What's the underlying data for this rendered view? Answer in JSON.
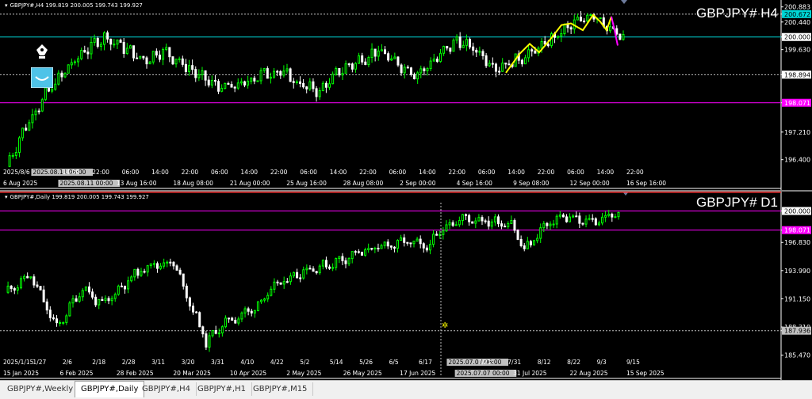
{
  "charts": {
    "h4": {
      "header": "GBPJPY#,H4  199.819 200.005 199.743 199.927",
      "title": "GBPJPY# H4",
      "price_labels": [
        {
          "text": "200.883",
          "price": 200.883,
          "bg": "#000000",
          "fg": "#ffffff"
        },
        {
          "text": "200.672",
          "price": 200.672,
          "bg": "#00d5d5",
          "fg": "#000000"
        },
        {
          "text": "200.440",
          "price": 200.44,
          "bg": "#000000",
          "fg": "#ffffff"
        },
        {
          "text": "200.000",
          "price": 200.0,
          "bg": "#ffffff",
          "fg": "#000000"
        },
        {
          "text": "199.630",
          "price": 199.63,
          "bg": "#000000",
          "fg": "#ffffff"
        },
        {
          "text": "198.894",
          "price": 198.894,
          "bg": "#ffffff",
          "fg": "#000000"
        },
        {
          "text": "198.071",
          "price": 198.071,
          "bg": "#ff00ff",
          "fg": "#ffffff"
        },
        {
          "text": "197.210",
          "price": 197.21,
          "bg": "#000000",
          "fg": "#ffffff"
        },
        {
          "text": "196.400",
          "price": 196.4,
          "bg": "#000000",
          "fg": "#ffffff"
        }
      ],
      "time_labels_top": [
        "2025/8/6",
        "2025.08.11 06:00",
        "14:00",
        "22:00",
        "06:00",
        "14:00",
        "22:00",
        "06:00",
        "14:00",
        "22:00",
        "06:00",
        "14:00",
        "22:00",
        "06:00",
        "14:00",
        "22:00",
        "06:00",
        "14:00",
        "22:00",
        "06:00",
        "14:00",
        "22:00"
      ],
      "time_labels_bottom": [
        "6 Aug 2025",
        "2025.08.11 00:00",
        "13 Aug 16:00",
        "18 Aug 08:00",
        "21 Aug 00:00",
        "25 Aug 16:00",
        "28 Aug 08:00",
        "2 Sep 00:00",
        "4 Sep 16:00",
        "9 Sep 08:00",
        "12 Sep 00:00",
        "16 Sep 16:00"
      ],
      "lines": {
        "cyan": "#00d5d5",
        "magenta": "#ff00ff",
        "dotted": "#c0c0c0"
      }
    },
    "d1": {
      "header": "GBPJPY#,Daily  199.819 200.005 199.743 199.927",
      "title": "GBPJPY# D1",
      "price_labels": [
        {
          "text": "200.000",
          "price": 200.0,
          "bg": "#ffffff",
          "fg": "#000000"
        },
        {
          "text": "198.071",
          "price": 198.071,
          "bg": "#ff00ff",
          "fg": "#ffffff"
        },
        {
          "text": "196.830",
          "price": 196.83,
          "bg": "#000000",
          "fg": "#ffffff"
        },
        {
          "text": "193.990",
          "price": 193.99,
          "bg": "#000000",
          "fg": "#ffffff"
        },
        {
          "text": "191.150",
          "price": 191.15,
          "bg": "#000000",
          "fg": "#ffffff"
        },
        {
          "text": "188.310",
          "price": 188.31,
          "bg": "#000000",
          "fg": "#ffffff"
        },
        {
          "text": "187.936",
          "price": 187.936,
          "bg": "#c0c0c0",
          "fg": "#000000"
        },
        {
          "text": "185.470",
          "price": 185.47,
          "bg": "#000000",
          "fg": "#ffffff"
        }
      ],
      "time_labels_top": [
        "2025/1/15",
        "1/27",
        "2/6",
        "2/18",
        "2/28",
        "3/11",
        "3/20",
        "3/31",
        "4/10",
        "4/22",
        "5/2",
        "5/14",
        "5/26",
        "6/5",
        "6/17",
        "2025.07.07 06:00",
        "7/21",
        "7/31",
        "8/12",
        "8/22",
        "9/3",
        "9/15"
      ],
      "time_labels_bottom": [
        "15 Jan 2025",
        "6 Feb 2025",
        "28 Feb 2025",
        "20 Mar 2025",
        "10 Apr 2025",
        "2 May 2025",
        "26 May 2025",
        "17 Jun 2025",
        "2025.07.07 00:00",
        "31 Jul 2025",
        "22 Aug 2025",
        "15 Sep 2025"
      ]
    }
  },
  "tabs": [
    {
      "label": "GBPJPY#,Weekly",
      "active": false
    },
    {
      "label": "GBPJPY#,Daily",
      "active": true
    },
    {
      "label": "GBPJPY#,H4",
      "active": false
    },
    {
      "label": "GBPJPY#,H1",
      "active": false
    },
    {
      "label": "GBPJPY#,M15",
      "active": false
    }
  ],
  "colors": {
    "bull": "#00ff00",
    "bear": "#ffffff",
    "cyan_line": "#00d5d5",
    "magenta_line": "#ff00ff",
    "yellow_overlay": "#ffff00",
    "red_line": "#ff3333"
  }
}
